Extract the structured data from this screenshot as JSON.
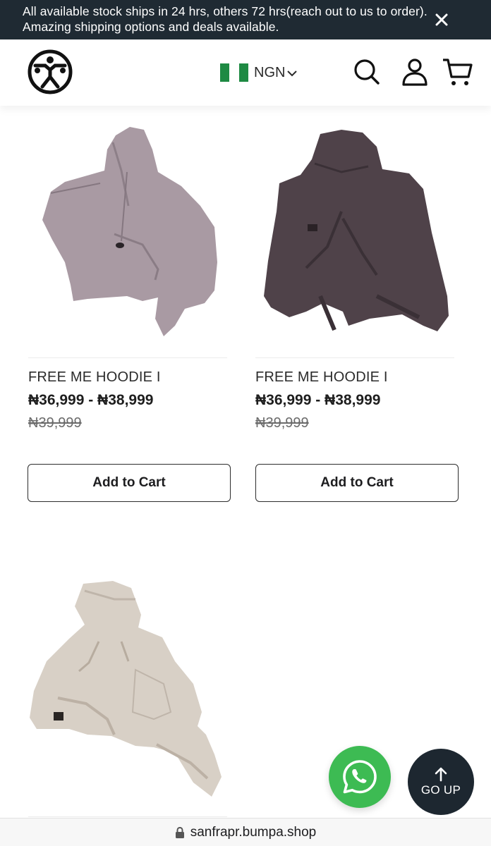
{
  "announcement": {
    "text": "All available stock ships in 24 hrs, others 72 hrs(reach out to us to order). Amazing shipping options and deals available.",
    "close_icon": "close-icon"
  },
  "header": {
    "logo_icon": "brand-logo-icon",
    "currency_code": "NGN",
    "flag_colors": [
      "#1e8a43",
      "#ffffff",
      "#1e8a43"
    ],
    "icons": [
      "search-icon",
      "user-icon",
      "cart-icon"
    ]
  },
  "products": [
    {
      "name": "FREE ME HOODIE I",
      "price": "₦36,999 - ₦38,999",
      "old_price": "₦39,999",
      "button_label": "Add to Cart",
      "color": "#a99aa3"
    },
    {
      "name": "FREE ME HOODIE I",
      "price": "₦36,999 - ₦38,999",
      "old_price": "₦39,999",
      "button_label": "Add to Cart",
      "color": "#4f4249"
    },
    {
      "color": "#d8d0c6"
    }
  ],
  "floating": {
    "whatsapp_icon": "whatsapp-icon",
    "go_up_label": "GO UP"
  },
  "browser": {
    "url": "sanfrapr.bumpa.shop",
    "lock_icon": "lock-icon"
  }
}
